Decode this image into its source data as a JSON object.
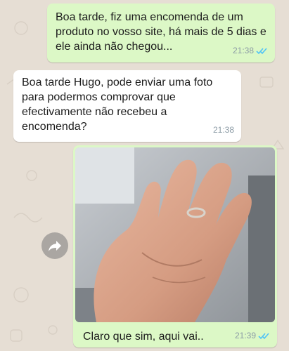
{
  "messages": [
    {
      "direction": "outgoing",
      "text": "Boa tarde, fiz uma encomenda de um produto no vosso site, há mais de 5 dias e ele ainda não chegou...",
      "time": "21:38",
      "status": "read-double-tick"
    },
    {
      "direction": "incoming",
      "text": "Boa tarde Hugo, pode enviar uma foto para podermos comprovar que efectivamente não recebeu a encomenda?",
      "time": "21:38"
    },
    {
      "direction": "outgoing",
      "type": "image",
      "image": "photo of an open palm wearing a ring",
      "caption": "Claro que sim, aqui vai..",
      "time": "21:39",
      "status": "read-double-tick"
    }
  ],
  "colors": {
    "chat_background": "#e6ded4",
    "outgoing_bubble": "#dcf8c6",
    "incoming_bubble": "#ffffff",
    "read_ticks": "#4fc3f7",
    "timestamp": "#8b9ba5"
  },
  "icons": [
    "double-check-icon",
    "forward-icon"
  ]
}
